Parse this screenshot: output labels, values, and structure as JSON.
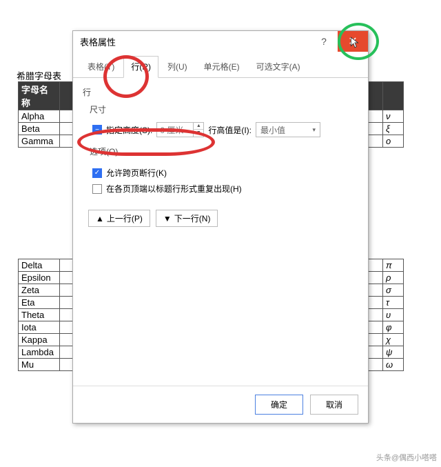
{
  "doc": {
    "title_text": "希腊字母表",
    "header": {
      "name": "字母名称"
    }
  },
  "rows_upper": [
    {
      "name": "Alpha",
      "sym": "ν"
    },
    {
      "name": "Beta",
      "sym": "ξ"
    },
    {
      "name": "Gamma",
      "sym": "ο"
    }
  ],
  "rows_lower": [
    {
      "name": "Delta",
      "sym": "π"
    },
    {
      "name": "Epsilon",
      "sym": "ρ"
    },
    {
      "name": "Zeta",
      "sym": "σ"
    },
    {
      "name": "Eta",
      "sym": "τ"
    },
    {
      "name": "Theta",
      "sym": "υ"
    },
    {
      "name": "Iota",
      "sym": "φ"
    },
    {
      "name": "Kappa",
      "sym": "χ"
    },
    {
      "name": "Lambda",
      "sym": "ψ"
    },
    {
      "name": "Mu",
      "sym": "ω"
    }
  ],
  "dialog": {
    "title": "表格属性",
    "help": "?",
    "close_x": "✕",
    "tabs": {
      "table": "表格(T)",
      "row": "行(R)",
      "col": "列(U)",
      "cell": "单元格(E)",
      "alt": "可选文字(A)"
    },
    "section_row": "行",
    "section_size": "尺寸",
    "spec_height_label": "指定高度(S):",
    "spec_height_value": "0 厘米",
    "row_height_label": "行高值是(I):",
    "row_height_value": "最小值",
    "options_label": "选项(O)",
    "allow_break_label": "允许跨页断行(K)",
    "repeat_header_label": "在各页顶端以标题行形式重复出现(H)",
    "prev_row": "上一行(P)",
    "next_row": "下一行(N)",
    "ok": "确定",
    "cancel": "取消"
  },
  "watermark": "头条@偶西小嗒嗒"
}
